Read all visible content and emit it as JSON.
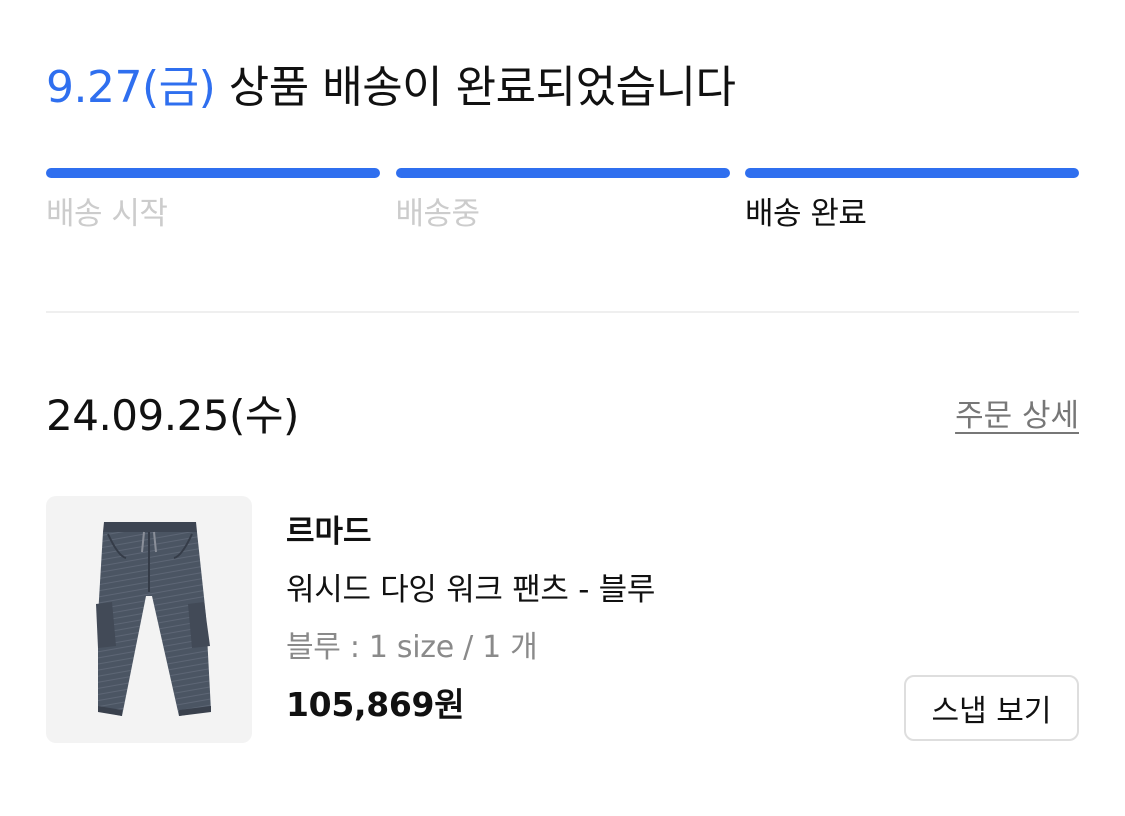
{
  "header": {
    "date": "9.27(금)",
    "message": "상품 배송이 완료되었습니다"
  },
  "progress": {
    "steps": [
      {
        "label": "배송 시작",
        "complete": true,
        "current": false
      },
      {
        "label": "배송중",
        "complete": true,
        "current": false
      },
      {
        "label": "배송 완료",
        "complete": true,
        "current": true
      }
    ],
    "accent_color": "#2f6fef"
  },
  "order": {
    "date": "24.09.25(수)",
    "detail_link": "주문 상세",
    "item": {
      "image_icon": "pants-product-image",
      "brand": "르마드",
      "name": "워시드 다잉 워크 팬츠 - 블루",
      "option": "블루 : 1 size / 1 개",
      "price": "105,869원",
      "snap_button": "스냅 보기"
    }
  }
}
